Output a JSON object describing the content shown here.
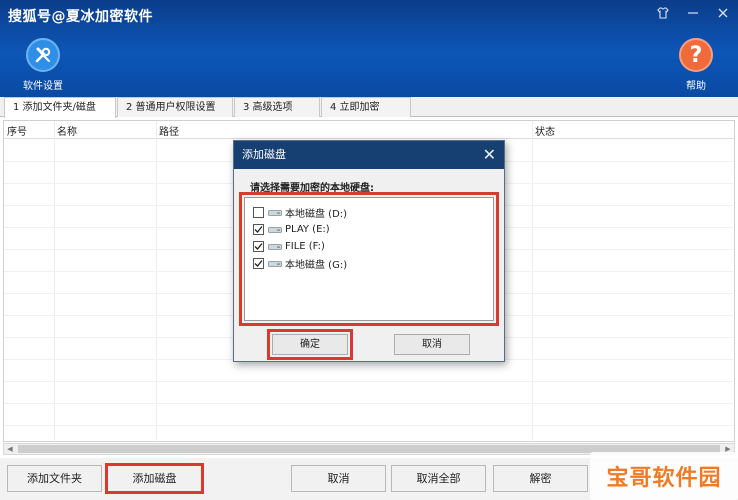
{
  "window": {
    "title": "搜狐号@夏冰加密软件",
    "controls": [
      "skin-icon",
      "minimize-icon",
      "close-icon"
    ]
  },
  "toolbar": {
    "settings_label": "软件设置",
    "help_label": "帮助",
    "help_glyph": "?"
  },
  "tabs": [
    {
      "label": "1 添加文件夹/磁盘",
      "active": true
    },
    {
      "label": "2 普通用户权限设置",
      "active": false
    },
    {
      "label": "3 高级选项",
      "active": false
    },
    {
      "label": "4 立即加密",
      "active": false
    }
  ],
  "table": {
    "columns": [
      "序号",
      "名称",
      "路径",
      "状态"
    ]
  },
  "dialog": {
    "title": "添加磁盘",
    "prompt": "请选择需要加密的本地硬盘:",
    "disks": [
      {
        "label": "本地磁盘 (D:)",
        "checked": false
      },
      {
        "label": "PLAY (E:)",
        "checked": true
      },
      {
        "label": "FILE (F:)",
        "checked": true
      },
      {
        "label": "本地磁盘 (G:)",
        "checked": true
      }
    ],
    "ok_label": "确定",
    "cancel_label": "取消"
  },
  "bottom": {
    "add_folder": "添加文件夹",
    "add_disk": "添加磁盘",
    "cancel": "取消",
    "cancel_all": "取消全部",
    "decrypt": "解密"
  },
  "watermark": "宝哥软件园",
  "colors": {
    "header": "#0d56b8",
    "dialog_title": "#163f72",
    "highlight": "#d83a2e",
    "help": "#f06a3c",
    "settings": "#2f8fe8"
  }
}
